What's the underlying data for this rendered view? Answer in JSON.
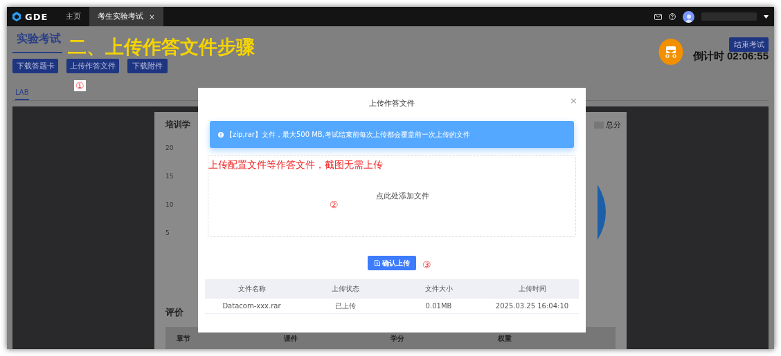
{
  "top_bar": {
    "logo": "GDE",
    "tabs": [
      {
        "label": "主页",
        "selected": false,
        "closable": false
      },
      {
        "label": "考生实验考试",
        "selected": true,
        "closable": true
      }
    ],
    "close_mark": "×"
  },
  "header": {
    "title": "实验考试",
    "buttons": [
      "下载答题卡",
      "上传作答文件",
      "下载附件"
    ],
    "end_button": "结束考试",
    "countdown": "倒计时 02:06:55"
  },
  "sub_tabs": [
    {
      "label": "LAB",
      "selected": true
    }
  ],
  "background_card": {
    "title": "培训学",
    "y_ticks": [
      "20",
      "15",
      "10",
      "5"
    ],
    "legend": "总分",
    "section_title": "评价",
    "table_columns": [
      "章节",
      "课件",
      "学分",
      "权重"
    ]
  },
  "modal": {
    "title": "上传作答文件",
    "close": "×",
    "notice": "【zip,rar】文件，最大500 MB,考试结束前每次上传都会覆盖前一次上传的文件",
    "dropzone": "点此处添加文件",
    "confirm_button": "确认上传",
    "table": {
      "columns": [
        "文件名称",
        "上传状态",
        "文件大小",
        "上传时间"
      ],
      "rows": [
        [
          "Datacom-xxx.rar",
          "已上传",
          "0.01MB",
          "2025.03.25 16:04:10"
        ]
      ]
    }
  },
  "annotations": {
    "headline": "二、上传作答文件步骤",
    "note": "上传配置文件等作答文件，截图无需上传",
    "steps": [
      "①",
      "②",
      "③"
    ]
  }
}
